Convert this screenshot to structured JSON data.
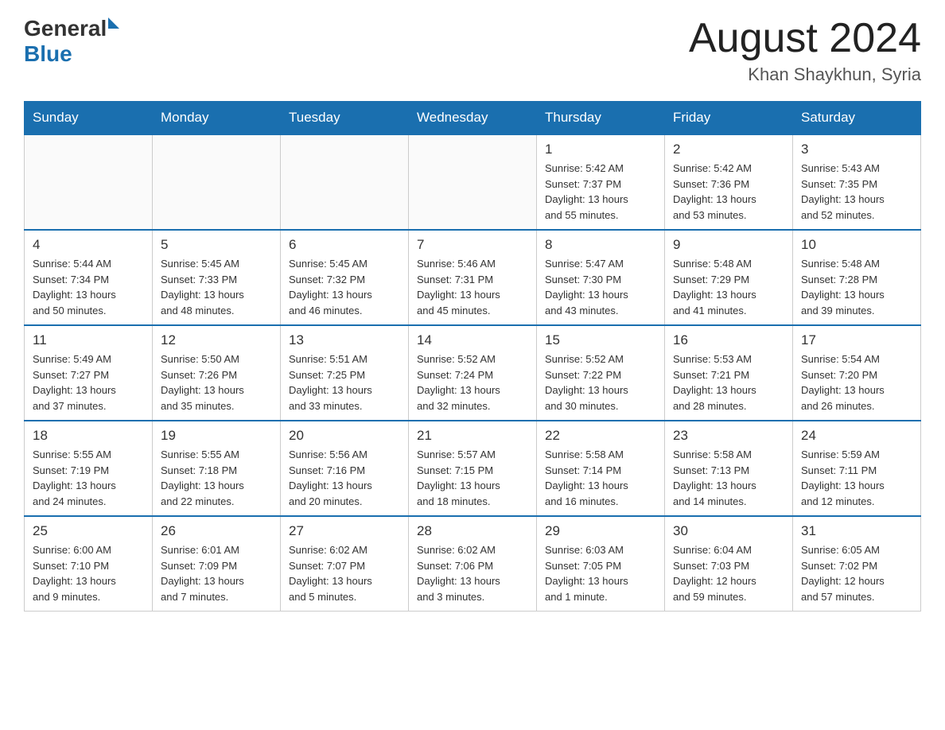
{
  "header": {
    "logo_general": "General",
    "logo_blue": "Blue",
    "month_title": "August 2024",
    "location": "Khan Shaykhun, Syria"
  },
  "days_of_week": [
    "Sunday",
    "Monday",
    "Tuesday",
    "Wednesday",
    "Thursday",
    "Friday",
    "Saturday"
  ],
  "weeks": [
    [
      {
        "day": "",
        "info": ""
      },
      {
        "day": "",
        "info": ""
      },
      {
        "day": "",
        "info": ""
      },
      {
        "day": "",
        "info": ""
      },
      {
        "day": "1",
        "info": "Sunrise: 5:42 AM\nSunset: 7:37 PM\nDaylight: 13 hours\nand 55 minutes."
      },
      {
        "day": "2",
        "info": "Sunrise: 5:42 AM\nSunset: 7:36 PM\nDaylight: 13 hours\nand 53 minutes."
      },
      {
        "day": "3",
        "info": "Sunrise: 5:43 AM\nSunset: 7:35 PM\nDaylight: 13 hours\nand 52 minutes."
      }
    ],
    [
      {
        "day": "4",
        "info": "Sunrise: 5:44 AM\nSunset: 7:34 PM\nDaylight: 13 hours\nand 50 minutes."
      },
      {
        "day": "5",
        "info": "Sunrise: 5:45 AM\nSunset: 7:33 PM\nDaylight: 13 hours\nand 48 minutes."
      },
      {
        "day": "6",
        "info": "Sunrise: 5:45 AM\nSunset: 7:32 PM\nDaylight: 13 hours\nand 46 minutes."
      },
      {
        "day": "7",
        "info": "Sunrise: 5:46 AM\nSunset: 7:31 PM\nDaylight: 13 hours\nand 45 minutes."
      },
      {
        "day": "8",
        "info": "Sunrise: 5:47 AM\nSunset: 7:30 PM\nDaylight: 13 hours\nand 43 minutes."
      },
      {
        "day": "9",
        "info": "Sunrise: 5:48 AM\nSunset: 7:29 PM\nDaylight: 13 hours\nand 41 minutes."
      },
      {
        "day": "10",
        "info": "Sunrise: 5:48 AM\nSunset: 7:28 PM\nDaylight: 13 hours\nand 39 minutes."
      }
    ],
    [
      {
        "day": "11",
        "info": "Sunrise: 5:49 AM\nSunset: 7:27 PM\nDaylight: 13 hours\nand 37 minutes."
      },
      {
        "day": "12",
        "info": "Sunrise: 5:50 AM\nSunset: 7:26 PM\nDaylight: 13 hours\nand 35 minutes."
      },
      {
        "day": "13",
        "info": "Sunrise: 5:51 AM\nSunset: 7:25 PM\nDaylight: 13 hours\nand 33 minutes."
      },
      {
        "day": "14",
        "info": "Sunrise: 5:52 AM\nSunset: 7:24 PM\nDaylight: 13 hours\nand 32 minutes."
      },
      {
        "day": "15",
        "info": "Sunrise: 5:52 AM\nSunset: 7:22 PM\nDaylight: 13 hours\nand 30 minutes."
      },
      {
        "day": "16",
        "info": "Sunrise: 5:53 AM\nSunset: 7:21 PM\nDaylight: 13 hours\nand 28 minutes."
      },
      {
        "day": "17",
        "info": "Sunrise: 5:54 AM\nSunset: 7:20 PM\nDaylight: 13 hours\nand 26 minutes."
      }
    ],
    [
      {
        "day": "18",
        "info": "Sunrise: 5:55 AM\nSunset: 7:19 PM\nDaylight: 13 hours\nand 24 minutes."
      },
      {
        "day": "19",
        "info": "Sunrise: 5:55 AM\nSunset: 7:18 PM\nDaylight: 13 hours\nand 22 minutes."
      },
      {
        "day": "20",
        "info": "Sunrise: 5:56 AM\nSunset: 7:16 PM\nDaylight: 13 hours\nand 20 minutes."
      },
      {
        "day": "21",
        "info": "Sunrise: 5:57 AM\nSunset: 7:15 PM\nDaylight: 13 hours\nand 18 minutes."
      },
      {
        "day": "22",
        "info": "Sunrise: 5:58 AM\nSunset: 7:14 PM\nDaylight: 13 hours\nand 16 minutes."
      },
      {
        "day": "23",
        "info": "Sunrise: 5:58 AM\nSunset: 7:13 PM\nDaylight: 13 hours\nand 14 minutes."
      },
      {
        "day": "24",
        "info": "Sunrise: 5:59 AM\nSunset: 7:11 PM\nDaylight: 13 hours\nand 12 minutes."
      }
    ],
    [
      {
        "day": "25",
        "info": "Sunrise: 6:00 AM\nSunset: 7:10 PM\nDaylight: 13 hours\nand 9 minutes."
      },
      {
        "day": "26",
        "info": "Sunrise: 6:01 AM\nSunset: 7:09 PM\nDaylight: 13 hours\nand 7 minutes."
      },
      {
        "day": "27",
        "info": "Sunrise: 6:02 AM\nSunset: 7:07 PM\nDaylight: 13 hours\nand 5 minutes."
      },
      {
        "day": "28",
        "info": "Sunrise: 6:02 AM\nSunset: 7:06 PM\nDaylight: 13 hours\nand 3 minutes."
      },
      {
        "day": "29",
        "info": "Sunrise: 6:03 AM\nSunset: 7:05 PM\nDaylight: 13 hours\nand 1 minute."
      },
      {
        "day": "30",
        "info": "Sunrise: 6:04 AM\nSunset: 7:03 PM\nDaylight: 12 hours\nand 59 minutes."
      },
      {
        "day": "31",
        "info": "Sunrise: 6:05 AM\nSunset: 7:02 PM\nDaylight: 12 hours\nand 57 minutes."
      }
    ]
  ]
}
